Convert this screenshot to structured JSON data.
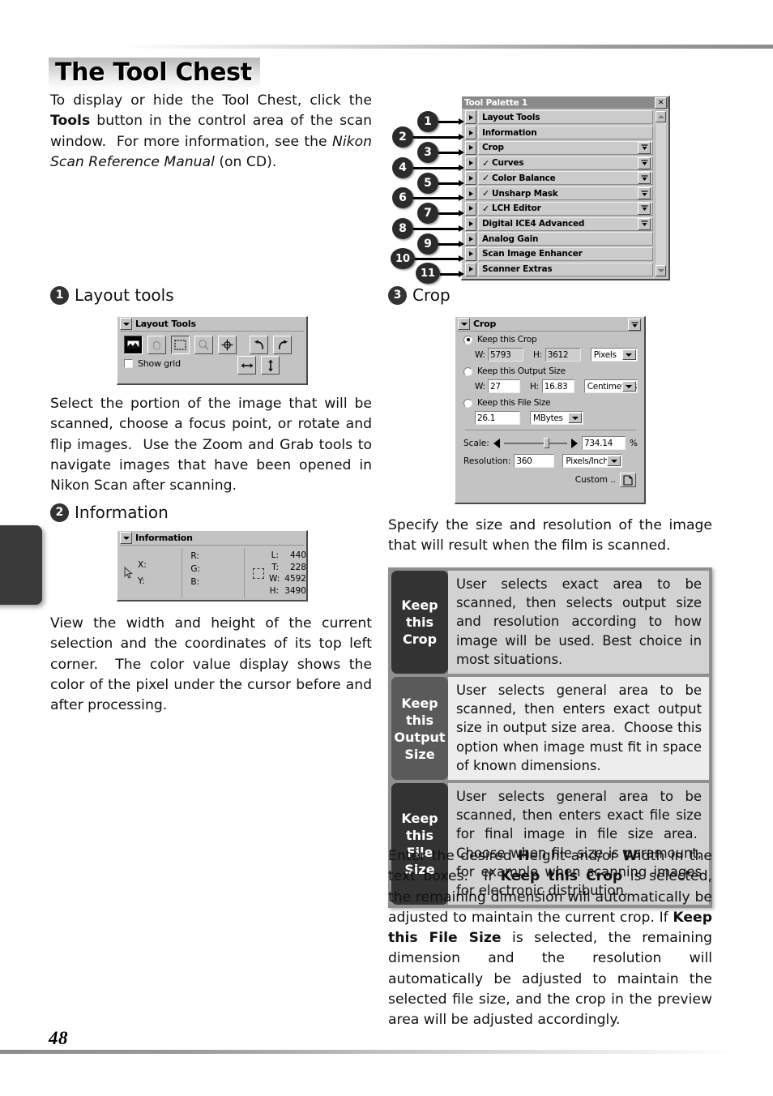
{
  "page": {
    "number": "48",
    "chapter_title": "The Tool Chest"
  },
  "intro": {
    "text_html": "To display or hide the Tool Chest, click the <b>Tools</b> button in the control area of the scan window.&nbsp; For more information, see the <i>Nikon Scan Reference Manual</i> (on CD)."
  },
  "tool_palette": {
    "window_title": "Tool Palette 1",
    "close_label": "✕",
    "rows": [
      {
        "callout": "1",
        "label": "Layout Tools",
        "checked": false,
        "has_mini": false
      },
      {
        "callout": "2",
        "label": "Information",
        "checked": false,
        "has_mini": false
      },
      {
        "callout": "3",
        "label": "Crop",
        "checked": false,
        "has_mini": true
      },
      {
        "callout": "4",
        "label": "Curves",
        "checked": true,
        "has_mini": true
      },
      {
        "callout": "5",
        "label": "Color Balance",
        "checked": true,
        "has_mini": true
      },
      {
        "callout": "6",
        "label": "Unsharp Mask",
        "checked": true,
        "has_mini": true
      },
      {
        "callout": "7",
        "label": "LCH Editor",
        "checked": true,
        "has_mini": true
      },
      {
        "callout": "8",
        "label": "Digital ICE4 Advanced",
        "checked": false,
        "has_mini": true
      },
      {
        "callout": "9",
        "label": "Analog Gain",
        "checked": false,
        "has_mini": false
      },
      {
        "callout": "10",
        "label": "Scan Image Enhancer",
        "checked": false,
        "has_mini": false
      },
      {
        "callout": "11",
        "label": "Scanner Extras",
        "checked": false,
        "has_mini": false
      }
    ],
    "check_glyph": "✓"
  },
  "sections": {
    "layout_tools": {
      "number": "1",
      "heading": "Layout tools",
      "body": "Select the portion of the image that will be scanned, choose a focus point, or rotate and flip images.  Use the Zoom and Grab tools to navigate images that have been opened in Nikon Scan after scanning."
    },
    "information": {
      "number": "2",
      "heading": "Information",
      "body": "View the width and height of the current selection and the coordinates of its top left corner.  The color value display shows the color of the pixel under the cursor before and after processing."
    },
    "crop": {
      "number": "3",
      "heading": "Crop",
      "body": "Specify the size and resolution of the image that will result when the film is scanned.",
      "footer_html": "Enter the desired <b>H</b>eight and/or <b>W</b>idth in the text boxes.&nbsp; If <b>Keep this Crop</b> is selected, the remaining dimension will automatically be adjusted to maintain the current crop. If <b>Keep this File Size</b> is selected, the remaining dimension and the resolution will automatically be adjusted to maintain the selected file size, and the crop in the preview area will be adjusted accordingly."
    }
  },
  "layout_tools_panel": {
    "title": "Layout Tools",
    "buttons": [
      {
        "name": "crop-select-tool",
        "glyph": "■",
        "state": "selected"
      },
      {
        "name": "grab-hand-tool",
        "glyph": "✋",
        "state": "disabled"
      },
      {
        "name": "marquee-tool",
        "glyph": "⬚",
        "state": "pressed"
      },
      {
        "name": "zoom-tool",
        "glyph": "⚲",
        "state": "disabled"
      },
      {
        "name": "autofocus-tool",
        "glyph": "⊕",
        "state": "normal"
      },
      {
        "name": "rotate-left-tool",
        "glyph": "↶",
        "state": "normal"
      },
      {
        "name": "rotate-right-tool",
        "glyph": "↷",
        "state": "normal"
      }
    ],
    "show_grid_label": "Show grid",
    "flip_buttons": [
      {
        "name": "flip-horizontal-tool",
        "glyph": "↔"
      },
      {
        "name": "flip-vertical-tool",
        "glyph": "↕"
      }
    ]
  },
  "information_panel": {
    "title": "Information",
    "cursor_x_label": "X:",
    "cursor_y_label": "Y:",
    "cursor_x_value": "",
    "cursor_y_value": "",
    "color": [
      {
        "label": "R:",
        "value": ""
      },
      {
        "label": "G:",
        "value": ""
      },
      {
        "label": "B:",
        "value": ""
      }
    ],
    "selection": [
      {
        "label": "L:",
        "value": "440"
      },
      {
        "label": "T:",
        "value": "228"
      },
      {
        "label": "W:",
        "value": "4592"
      },
      {
        "label": "H:",
        "value": "3490"
      }
    ]
  },
  "crop_panel": {
    "title": "Crop",
    "keep_this_crop": {
      "label": "Keep this Crop",
      "selected": true,
      "w_label": "W:",
      "w_value": "5793",
      "h_label": "H:",
      "h_value": "3612",
      "unit": "Pixels"
    },
    "keep_this_output_size": {
      "label": "Keep this Output Size",
      "selected": false,
      "w_label": "W:",
      "w_value": "27",
      "h_label": "H:",
      "h_value": "16.83",
      "unit": "Centimeters"
    },
    "keep_this_file_size": {
      "label": "Keep this File Size",
      "selected": false,
      "value": "26.1",
      "unit": "MBytes"
    },
    "scale_label": "Scale:",
    "scale_value": "734.14",
    "scale_percent": "%",
    "resolution_label": "Resolution:",
    "resolution_value": "360",
    "resolution_unit": "Pixels/Inch",
    "custom_label": "Custom .."
  },
  "option_table": {
    "rows": [
      {
        "key": "Keep this Crop",
        "key_lines": [
          "Keep",
          "this",
          "Crop"
        ],
        "description": "User selects exact area to be scanned, then selects output size and resolution according to how image will be used. Best choice in most situations."
      },
      {
        "key": "Keep this Output Size",
        "key_lines": [
          "Keep",
          "this",
          "Output",
          "Size"
        ],
        "description": "User selects general area to be scanned, then enters exact output size in output size area.  Choose this option when image must fit in space of known dimensions."
      },
      {
        "key": "Keep this File Size",
        "key_lines": [
          "Keep",
          "this",
          "File",
          "Size"
        ],
        "description": "User selects general area to be scanned, then enters exact file size for final image in file size area.  Choose when file size is paramount, for example when scanning images for electronic distribution."
      }
    ]
  }
}
